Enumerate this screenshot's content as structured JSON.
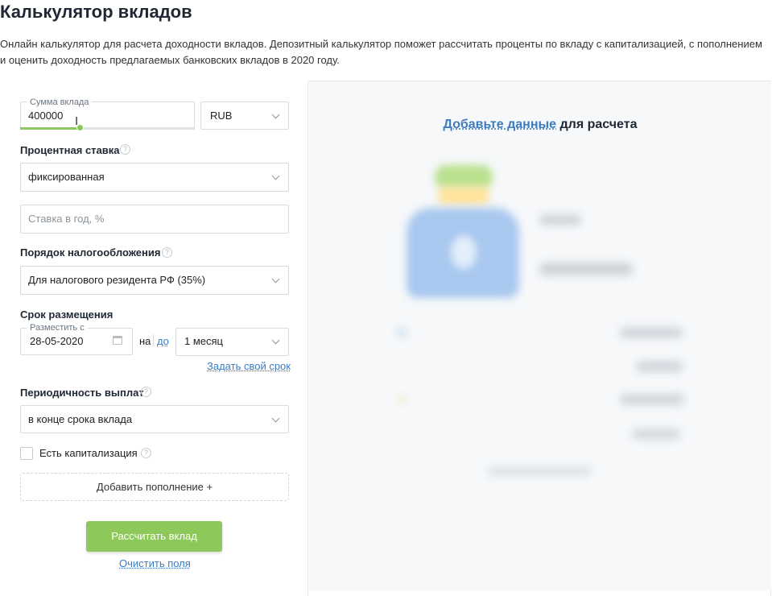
{
  "page": {
    "title": "Калькулятор вкладов",
    "description": "Онлайн калькулятор для расчета доходности вкладов. Депозитный калькулятор поможет рассчитать проценты по вкладу с капитализацией, с пополнением и оценить доходность предлагаемых банковских вкладов в 2020 году."
  },
  "form": {
    "amount": {
      "legend": "Сумма вклада",
      "value": "400000",
      "slider_fraction": 0.34
    },
    "currency": {
      "selected": "RUB"
    },
    "rate": {
      "label": "Процентная ставка",
      "type_selected": "фиксированная",
      "input_placeholder": "Ставка в год, %"
    },
    "tax": {
      "label": "Порядок налогообложения",
      "selected": "Для налогового резидента РФ (35%)"
    },
    "term": {
      "label": "Срок размещения",
      "date_legend": "Разместить с",
      "date_value": "28-05-2020",
      "on_text": "на",
      "to_link": "до",
      "duration_selected": "1 месяц",
      "custom_term_link": "Задать свой срок"
    },
    "payouts": {
      "label": "Периодичность выплат",
      "selected": "в конце срока вклада"
    },
    "capitalization_label": "Есть капитализация",
    "add_topup": "Добавить пополнение +",
    "calculate": "Рассчитать вклад",
    "clear": "Очистить поля"
  },
  "result": {
    "prompt_link": "Добавьте данные",
    "prompt_rest": " для расчета"
  },
  "colors": {
    "accent_green": "#8dc95a",
    "link_blue": "#3d7cc0",
    "placeholder_bag": "#a9c8ef"
  }
}
